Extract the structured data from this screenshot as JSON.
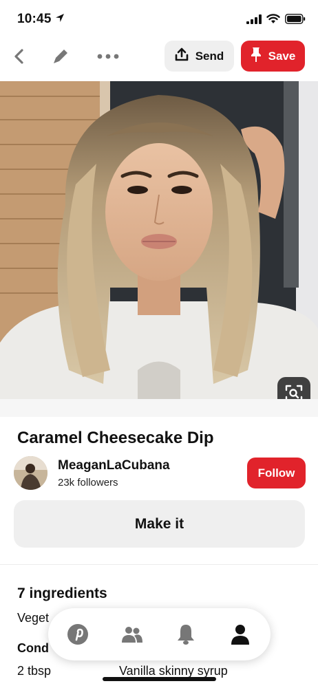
{
  "status_bar": {
    "time": "10:45",
    "location_icon": "location-arrow-icon",
    "signal_icon": "cellular-signal-icon",
    "wifi_icon": "wifi-icon",
    "battery_icon": "battery-icon"
  },
  "toolbar": {
    "back_icon": "chevron-left-icon",
    "edit_icon": "pencil-icon",
    "more_icon": "ellipsis-icon",
    "send_label": "Send",
    "save_label": "Save"
  },
  "pin": {
    "image_alt": "Woman with wavy balayage hair taking a selfie",
    "lens_icon": "visual-search-icon",
    "title": "Caramel Cheesecake Dip"
  },
  "creator": {
    "name": "MeaganLaCubana",
    "followers": "23k followers",
    "follow_label": "Follow"
  },
  "make_it_label": "Make it",
  "ingredients": {
    "title": "7 ingredients",
    "category_1": "Veget",
    "category_2": "Cond",
    "item_qty": "2 tbsp",
    "item_name": "Vanilla skinny syrup"
  },
  "bottom_nav": {
    "items": [
      {
        "icon": "pinterest-home-icon"
      },
      {
        "icon": "following-people-icon"
      },
      {
        "icon": "notifications-bell-icon"
      },
      {
        "icon": "profile-icon"
      }
    ]
  },
  "colors": {
    "brand_red": "#e1232b",
    "button_gray": "#efefef"
  }
}
